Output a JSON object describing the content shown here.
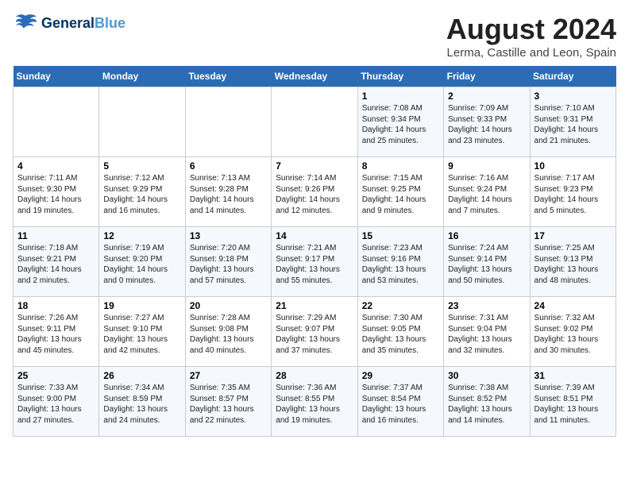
{
  "header": {
    "logo_line1": "General",
    "logo_line2": "Blue",
    "month": "August 2024",
    "location": "Lerma, Castille and Leon, Spain"
  },
  "weekdays": [
    "Sunday",
    "Monday",
    "Tuesday",
    "Wednesday",
    "Thursday",
    "Friday",
    "Saturday"
  ],
  "weeks": [
    [
      {
        "day": "",
        "info": ""
      },
      {
        "day": "",
        "info": ""
      },
      {
        "day": "",
        "info": ""
      },
      {
        "day": "",
        "info": ""
      },
      {
        "day": "1",
        "info": "Sunrise: 7:08 AM\nSunset: 9:34 PM\nDaylight: 14 hours and 25 minutes."
      },
      {
        "day": "2",
        "info": "Sunrise: 7:09 AM\nSunset: 9:33 PM\nDaylight: 14 hours and 23 minutes."
      },
      {
        "day": "3",
        "info": "Sunrise: 7:10 AM\nSunset: 9:31 PM\nDaylight: 14 hours and 21 minutes."
      }
    ],
    [
      {
        "day": "4",
        "info": "Sunrise: 7:11 AM\nSunset: 9:30 PM\nDaylight: 14 hours and 19 minutes."
      },
      {
        "day": "5",
        "info": "Sunrise: 7:12 AM\nSunset: 9:29 PM\nDaylight: 14 hours and 16 minutes."
      },
      {
        "day": "6",
        "info": "Sunrise: 7:13 AM\nSunset: 9:28 PM\nDaylight: 14 hours and 14 minutes."
      },
      {
        "day": "7",
        "info": "Sunrise: 7:14 AM\nSunset: 9:26 PM\nDaylight: 14 hours and 12 minutes."
      },
      {
        "day": "8",
        "info": "Sunrise: 7:15 AM\nSunset: 9:25 PM\nDaylight: 14 hours and 9 minutes."
      },
      {
        "day": "9",
        "info": "Sunrise: 7:16 AM\nSunset: 9:24 PM\nDaylight: 14 hours and 7 minutes."
      },
      {
        "day": "10",
        "info": "Sunrise: 7:17 AM\nSunset: 9:23 PM\nDaylight: 14 hours and 5 minutes."
      }
    ],
    [
      {
        "day": "11",
        "info": "Sunrise: 7:18 AM\nSunset: 9:21 PM\nDaylight: 14 hours and 2 minutes."
      },
      {
        "day": "12",
        "info": "Sunrise: 7:19 AM\nSunset: 9:20 PM\nDaylight: 14 hours and 0 minutes."
      },
      {
        "day": "13",
        "info": "Sunrise: 7:20 AM\nSunset: 9:18 PM\nDaylight: 13 hours and 57 minutes."
      },
      {
        "day": "14",
        "info": "Sunrise: 7:21 AM\nSunset: 9:17 PM\nDaylight: 13 hours and 55 minutes."
      },
      {
        "day": "15",
        "info": "Sunrise: 7:23 AM\nSunset: 9:16 PM\nDaylight: 13 hours and 53 minutes."
      },
      {
        "day": "16",
        "info": "Sunrise: 7:24 AM\nSunset: 9:14 PM\nDaylight: 13 hours and 50 minutes."
      },
      {
        "day": "17",
        "info": "Sunrise: 7:25 AM\nSunset: 9:13 PM\nDaylight: 13 hours and 48 minutes."
      }
    ],
    [
      {
        "day": "18",
        "info": "Sunrise: 7:26 AM\nSunset: 9:11 PM\nDaylight: 13 hours and 45 minutes."
      },
      {
        "day": "19",
        "info": "Sunrise: 7:27 AM\nSunset: 9:10 PM\nDaylight: 13 hours and 42 minutes."
      },
      {
        "day": "20",
        "info": "Sunrise: 7:28 AM\nSunset: 9:08 PM\nDaylight: 13 hours and 40 minutes."
      },
      {
        "day": "21",
        "info": "Sunrise: 7:29 AM\nSunset: 9:07 PM\nDaylight: 13 hours and 37 minutes."
      },
      {
        "day": "22",
        "info": "Sunrise: 7:30 AM\nSunset: 9:05 PM\nDaylight: 13 hours and 35 minutes."
      },
      {
        "day": "23",
        "info": "Sunrise: 7:31 AM\nSunset: 9:04 PM\nDaylight: 13 hours and 32 minutes."
      },
      {
        "day": "24",
        "info": "Sunrise: 7:32 AM\nSunset: 9:02 PM\nDaylight: 13 hours and 30 minutes."
      }
    ],
    [
      {
        "day": "25",
        "info": "Sunrise: 7:33 AM\nSunset: 9:00 PM\nDaylight: 13 hours and 27 minutes."
      },
      {
        "day": "26",
        "info": "Sunrise: 7:34 AM\nSunset: 8:59 PM\nDaylight: 13 hours and 24 minutes."
      },
      {
        "day": "27",
        "info": "Sunrise: 7:35 AM\nSunset: 8:57 PM\nDaylight: 13 hours and 22 minutes."
      },
      {
        "day": "28",
        "info": "Sunrise: 7:36 AM\nSunset: 8:55 PM\nDaylight: 13 hours and 19 minutes."
      },
      {
        "day": "29",
        "info": "Sunrise: 7:37 AM\nSunset: 8:54 PM\nDaylight: 13 hours and 16 minutes."
      },
      {
        "day": "30",
        "info": "Sunrise: 7:38 AM\nSunset: 8:52 PM\nDaylight: 13 hours and 14 minutes."
      },
      {
        "day": "31",
        "info": "Sunrise: 7:39 AM\nSunset: 8:51 PM\nDaylight: 13 hours and 11 minutes."
      }
    ]
  ]
}
